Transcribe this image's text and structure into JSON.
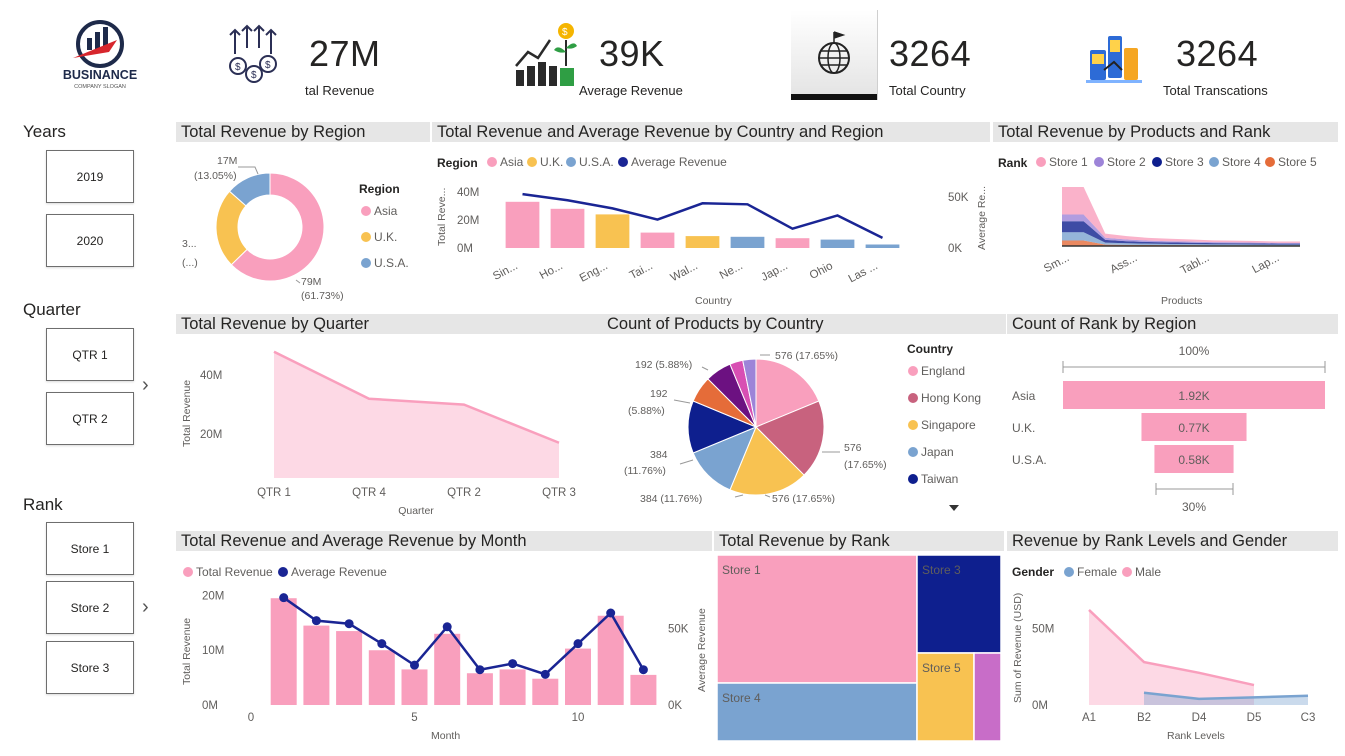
{
  "logo": {
    "name": "BUSINANCE",
    "slogan": "COMPANY SLOGAN"
  },
  "kpis": [
    {
      "value": "27M",
      "label": "tal Revenue",
      "icon": "money-arrows-icon"
    },
    {
      "value": "39K",
      "label": "Average Revenue",
      "icon": "growth-plant-icon"
    },
    {
      "value": "3264",
      "label": "Total Country",
      "icon": "globe-flag-icon"
    },
    {
      "value": "3264",
      "label": "Total Transcations",
      "icon": "payment-terminal-icon"
    }
  ],
  "slicers": {
    "years": {
      "title": "Years",
      "items": [
        "2019",
        "2020"
      ]
    },
    "quarter": {
      "title": "Quarter",
      "items": [
        "QTR 1",
        "QTR 2"
      ]
    },
    "rank": {
      "title": "Rank",
      "items": [
        "Store 1",
        "Store 2",
        "Store 3"
      ]
    }
  },
  "colors": {
    "asia": "#f99fbd",
    "uk": "#f8c251",
    "usa": "#7aa3d0",
    "avg": "#1a2594",
    "store1": "#f99fbd",
    "store2": "#9d84d8",
    "store3": "#0e1f8e",
    "store4": "#7aa3d0",
    "store5": "#e56c39",
    "title_bg": "#e6e6e6"
  },
  "titles": {
    "region_donut": "Total Revenue by Region",
    "country_combo": "Total Revenue and Average Revenue by Country and Region",
    "products_area": "Total Revenue by Products and Rank",
    "quarter_area": "Total Revenue by Quarter",
    "country_pie": "Count of Products by Country",
    "rank_funnel": "Count of Rank by Region",
    "month_combo": "Total Revenue and Average Revenue by Month",
    "rank_treemap": "Total Revenue by Rank",
    "gender_area": "Revenue by Rank Levels and Gender"
  },
  "chart_data": [
    {
      "id": "region_donut",
      "type": "pie",
      "legend_title": "Region",
      "categories": [
        "Asia",
        "U.K.",
        "U.S.A."
      ],
      "values": [
        79,
        30,
        17
      ],
      "labels": [
        "79M",
        "3...",
        "17M"
      ],
      "pct_labels": [
        "(61.73%)",
        "(...)",
        "(13.05%)"
      ]
    },
    {
      "id": "country_combo",
      "type": "bar",
      "legend_title": "Region",
      "legend": [
        "Asia",
        "U.K.",
        "U.S.A.",
        "Average Revenue"
      ],
      "categories": [
        "Sin...",
        "Ho...",
        "Eng...",
        "Tai...",
        "Wal...",
        "Ne...",
        "Jap...",
        "Ohio",
        "Las ..."
      ],
      "region": [
        "Asia",
        "Asia",
        "U.K.",
        "Asia",
        "U.K.",
        "U.S.A.",
        "Asia",
        "U.S.A.",
        "U.S.A."
      ],
      "values": [
        33,
        28,
        24,
        11,
        8.5,
        8,
        7,
        6,
        2.5
      ],
      "line_values": [
        53,
        47,
        39,
        28,
        44,
        43,
        19,
        32,
        10
      ],
      "xlabel": "Country",
      "ylabel": "Total Reve...",
      "y2label": "Average Re...",
      "yticks": [
        "0M",
        "20M",
        "40M"
      ],
      "y2ticks": [
        "0K",
        "50K"
      ],
      "ylim": [
        0,
        45
      ],
      "y2lim": [
        0,
        62
      ]
    },
    {
      "id": "products_area",
      "type": "area",
      "legend_title": "Rank",
      "series": [
        {
          "name": "Store 1",
          "values": [
            20,
            20,
            3,
            2.5,
            2,
            1.8,
            1.5,
            1.3,
            1.2,
            1.1,
            1,
            1
          ]
        },
        {
          "name": "Store 2",
          "values": [
            5,
            5,
            1.5,
            1.2,
            1,
            0.9,
            0.8,
            0.7,
            0.7,
            0.6,
            0.6,
            0.6
          ]
        },
        {
          "name": "Store 3",
          "values": [
            8,
            8,
            2,
            1.5,
            1.2,
            1.1,
            1,
            0.9,
            0.8,
            0.8,
            0.7,
            0.7
          ]
        },
        {
          "name": "Store 4",
          "values": [
            6,
            6,
            1.5,
            1.2,
            1,
            0.9,
            0.8,
            0.7,
            0.7,
            0.6,
            0.6,
            0.6
          ]
        },
        {
          "name": "Store 5",
          "values": [
            4,
            4,
            1,
            0.8,
            0.7,
            0.6,
            0.6,
            0.5,
            0.5,
            0.5,
            0.4,
            0.4
          ]
        }
      ],
      "tick_labels": [
        "Sm...",
        "Ass...",
        "Tabl...",
        "Lap..."
      ],
      "xlabel": "Products"
    },
    {
      "id": "quarter_area",
      "type": "area",
      "categories": [
        "QTR 1",
        "QTR 4",
        "QTR 2",
        "QTR 3"
      ],
      "values": [
        48,
        32,
        30,
        17
      ],
      "xlabel": "Quarter",
      "ylabel": "Total Revenue",
      "yticks": [
        "20M",
        "40M"
      ],
      "ylim": [
        5,
        52
      ]
    },
    {
      "id": "country_pie",
      "type": "pie",
      "legend_title": "Country",
      "legend": [
        "England",
        "Hong Kong",
        "Singapore",
        "Japan",
        "Taiwan"
      ],
      "legend_colors": [
        "#f99fbd",
        "#c8627e",
        "#f8c251",
        "#7aa3d0",
        "#0e1f8e"
      ],
      "values": [
        576,
        576,
        576,
        384,
        384,
        192,
        192,
        96,
        96
      ],
      "colors": [
        "#f99fbd",
        "#c8627e",
        "#f8c251",
        "#7aa3d0",
        "#0e1f8e",
        "#e56c39",
        "#6c1181",
        "#d84fb3",
        "#9d84d8"
      ],
      "labels": [
        {
          "a": "576 (17.65%)"
        },
        {
          "a": "576",
          "b": "(17.65%)"
        },
        {
          "a": "576 (17.65%)"
        },
        {
          "a": "384 (11.76%)"
        },
        {
          "a": "384",
          "b": "(11.76%)"
        },
        {
          "a": "192",
          "b": "(5.88%)"
        },
        {
          "a": "192 (5.88%)"
        }
      ]
    },
    {
      "id": "rank_funnel",
      "type": "bar",
      "categories": [
        "Asia",
        "U.K.",
        "U.S.A."
      ],
      "values": [
        1.92,
        0.77,
        0.58
      ],
      "labels": [
        "1.92K",
        "0.77K",
        "0.58K"
      ],
      "top_label": "100%",
      "bottom_label": "30%"
    },
    {
      "id": "month_combo",
      "type": "bar",
      "legend": [
        "Total Revenue",
        "Average Revenue"
      ],
      "x": [
        1,
        2,
        3,
        4,
        5,
        6,
        7,
        8,
        9,
        10,
        11,
        12
      ],
      "values": [
        19.5,
        14.5,
        13.5,
        10,
        6.5,
        13,
        5.8,
        6.5,
        4.8,
        10.3,
        16.3,
        5.5
      ],
      "line_values": [
        70,
        55,
        53,
        40,
        26,
        51,
        23,
        27,
        20,
        40,
        60,
        23
      ],
      "xlabel": "Month",
      "ylabel": "Total Revenue",
      "y2label": "Average Revenue",
      "xticks": [
        "0",
        "5",
        "10"
      ],
      "yticks": [
        "0M",
        "10M",
        "20M"
      ],
      "y2ticks": [
        "0K",
        "50K"
      ],
      "ylim": [
        0,
        21
      ],
      "y2lim": [
        0,
        75
      ]
    },
    {
      "id": "rank_treemap",
      "type": "heatmap",
      "categories": [
        "Store 1",
        "Store 3",
        "Store 4",
        "Store 5",
        "Store 2"
      ],
      "values": [
        9.7,
        3.0,
        4.6,
        1.3,
        0.6
      ]
    },
    {
      "id": "gender_area",
      "type": "area",
      "legend_title": "Gender",
      "categories": [
        "A1",
        "B2",
        "D4",
        "D5",
        "C3"
      ],
      "series": [
        {
          "name": "Female",
          "values": [
            null,
            8,
            4,
            5,
            6
          ]
        },
        {
          "name": "Male",
          "values": [
            62,
            28,
            21,
            13,
            null
          ]
        }
      ],
      "xlabel": "Rank Levels",
      "ylabel": "Sum of Revenue (USD)",
      "yticks": [
        "0M",
        "50M"
      ],
      "ylim": [
        0,
        75
      ]
    }
  ]
}
